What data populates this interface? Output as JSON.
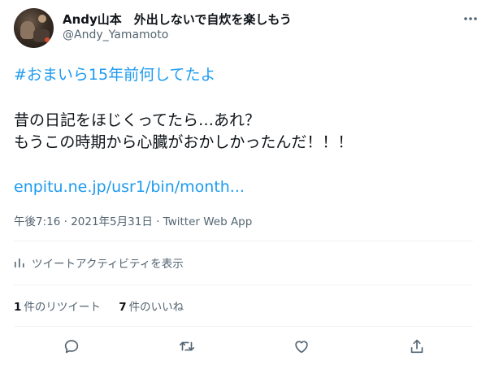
{
  "tweet": {
    "author": {
      "display_name": "Andy山本　外出しないで自炊を楽しもう",
      "handle": "@Andy_Yamamoto"
    },
    "hashtag": "#おまいら15年前何してたよ",
    "body_lines": [
      "昔の日記をほじくってたら…あれ？",
      "もうこの時期から心臓がおかしかったんだ！！！"
    ],
    "link": "enpitu.ne.jp/usr1/bin/month...",
    "meta": "午後7:16 · 2021年5月31日 · Twitter Web App",
    "activity_label": "ツイートアクティビティを表示",
    "stats": {
      "retweets_count": "1",
      "retweets_label": "件のリツイート",
      "likes_count": "7",
      "likes_label": "件のいいね"
    },
    "actions": [
      "reply-icon",
      "retweet-icon",
      "like-icon",
      "share-icon"
    ],
    "colors": {
      "link": "#1d9bf0",
      "text": "#0f1419",
      "secondary": "#536471",
      "divider": "#eff3f4"
    }
  }
}
